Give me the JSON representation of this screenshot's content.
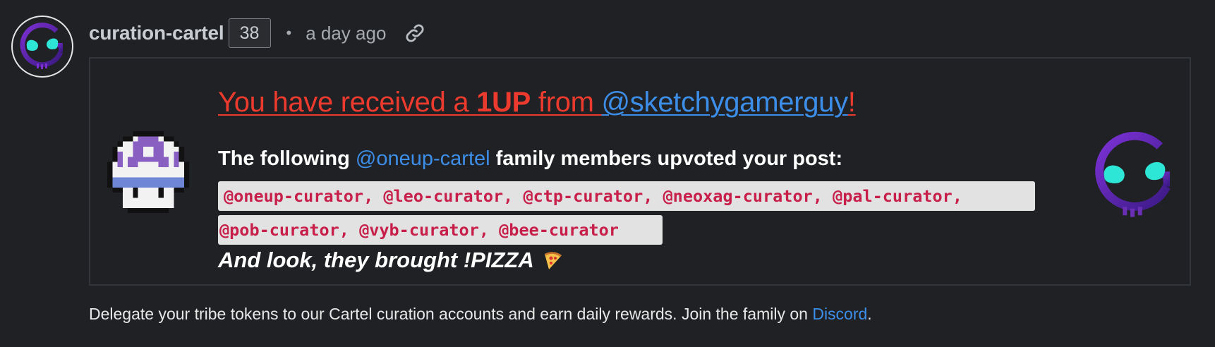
{
  "comment": {
    "author": "curation-cartel",
    "reputation": "38",
    "separator": "•",
    "timestamp": "a day ago",
    "icons": {
      "avatar": "cartel-logo-icon",
      "permalink": "link-icon"
    }
  },
  "card": {
    "title_prefix": "You have received a ",
    "title_bold": "1UP",
    "title_from": " from ",
    "title_user": "@sketchygamerguy",
    "title_bang": "!",
    "following_prefix": "The following ",
    "following_link": "@oneup-cartel",
    "following_suffix": " family members upvoted your post:",
    "curators_line1": "@oneup-curator, @leo-curator, @ctp-curator, @neoxag-curator, @pal-curator,",
    "curators_line2": "@pob-curator, @vyb-curator, @bee-curator",
    "pizza_text": "And look, they brought !PIZZA",
    "icons": {
      "left": "mushroom-1up-icon",
      "right": "cartel-logo-icon",
      "pizza": "pizza-icon"
    }
  },
  "footer": {
    "text": "Delegate your tribe tokens to our Cartel curation accounts and earn daily rewards. Join the family on ",
    "link": "Discord",
    "end": "."
  },
  "colors": {
    "background": "#1f2124",
    "title_red": "#ec3b2e",
    "link_blue": "#3d8ee8",
    "code_text": "#c71f4a",
    "code_bg": "#e2e2e2",
    "logo_teal": "#2ee6d6",
    "logo_purple": "#6a2fb5"
  }
}
